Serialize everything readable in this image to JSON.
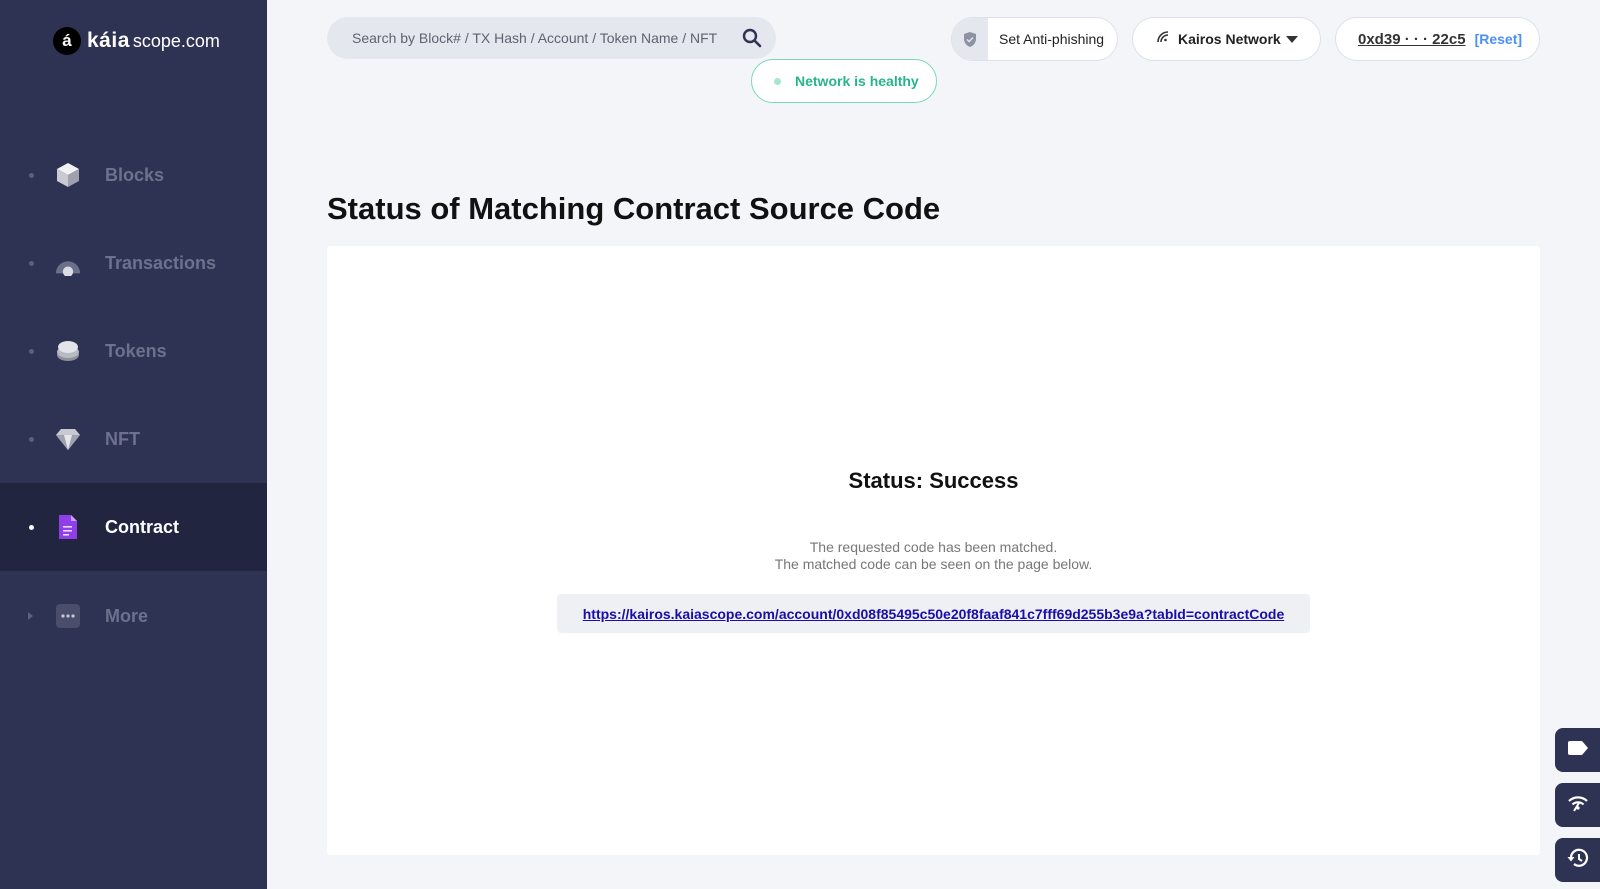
{
  "brand": {
    "mark": "á",
    "word": "káia",
    "domain": "scope.com"
  },
  "sidebar": {
    "items": [
      {
        "label": "Blocks",
        "icon": "cube-icon",
        "active": false
      },
      {
        "label": "Transactions",
        "icon": "transactions-icon",
        "active": false
      },
      {
        "label": "Tokens",
        "icon": "coins-icon",
        "active": false
      },
      {
        "label": "NFT",
        "icon": "diamond-icon",
        "active": false
      },
      {
        "label": "Contract",
        "icon": "document-icon",
        "active": true
      },
      {
        "label": "More",
        "icon": "more-icon",
        "active": false
      }
    ]
  },
  "header": {
    "search_placeholder": "Search by Block# / TX Hash / Account / Token Name / NFT",
    "anti_phishing_label": "Set Anti-phishing",
    "network_label": "Kairos Network",
    "account_address": "0xd39 · · · 22c5",
    "reset_label": "[Reset]",
    "health_label": "Network is healthy"
  },
  "main": {
    "title": "Status of Matching Contract Source Code",
    "status_title": "Status: Success",
    "message_line1": "The requested code has been matched.",
    "message_line2": "The matched code can be seen on the page below.",
    "url": "https://kairos.kaiascope.com/account/0xd08f85495c50e20f8faaf841c7fff69d255b3e9a?tabId=contractCode"
  },
  "float_buttons": [
    {
      "icon": "tag-icon"
    },
    {
      "icon": "network-icon"
    },
    {
      "icon": "history-icon"
    }
  ],
  "colors": {
    "sidebar_bg": "#2f3353",
    "sidebar_active_bg": "#22253f",
    "health_green": "#27b58c",
    "reset_blue": "#4a8ff7",
    "link_blue": "#1a0dab",
    "contract_purple": "#8f3fe8"
  }
}
